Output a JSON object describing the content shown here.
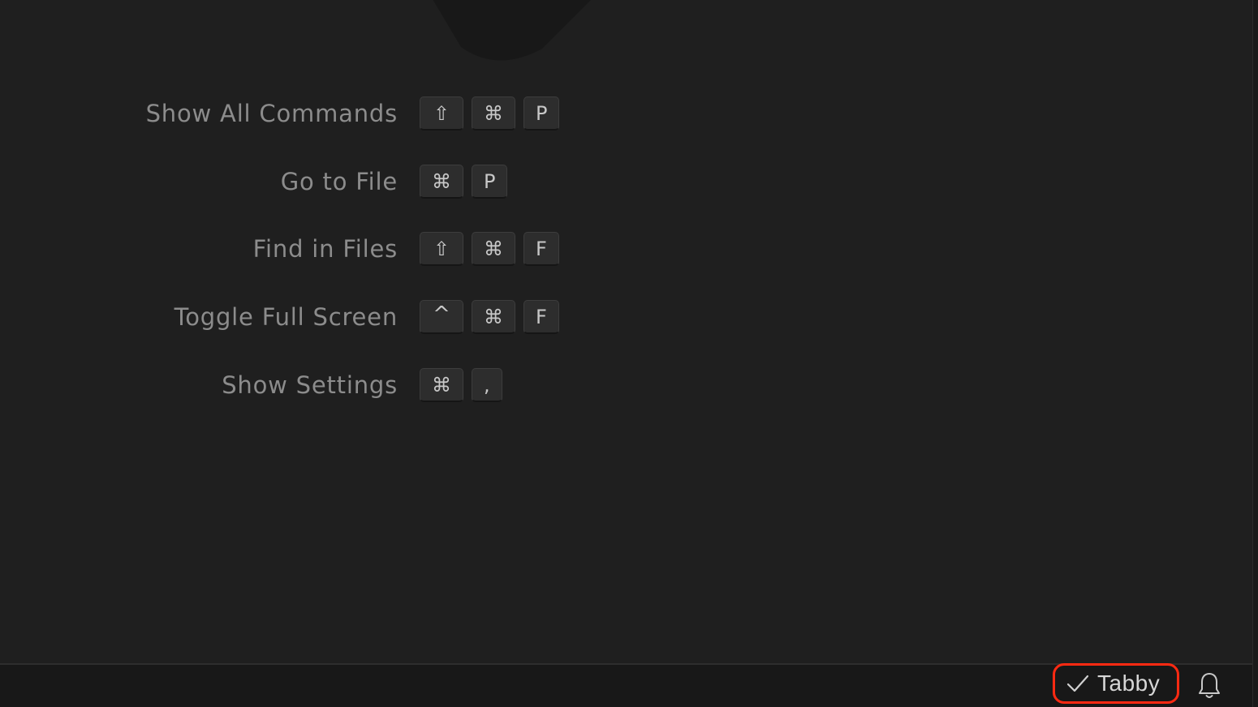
{
  "shortcuts": [
    {
      "label": "Show All Commands",
      "keys": [
        "⇧",
        "⌘",
        "P"
      ]
    },
    {
      "label": "Go to File",
      "keys": [
        "⌘",
        "P"
      ]
    },
    {
      "label": "Find in Files",
      "keys": [
        "⇧",
        "⌘",
        "F"
      ]
    },
    {
      "label": "Toggle Full Screen",
      "keys": [
        "^",
        "⌘",
        "F"
      ]
    },
    {
      "label": "Show Settings",
      "keys": [
        "⌘",
        ","
      ]
    }
  ],
  "status_bar": {
    "tabby": {
      "icon": "check-icon",
      "label": "Tabby"
    },
    "notifications": {
      "icon": "bell-icon"
    }
  },
  "colors": {
    "highlight": "#ff2a12",
    "background": "#1f1f1f",
    "status_bar": "#181818"
  }
}
